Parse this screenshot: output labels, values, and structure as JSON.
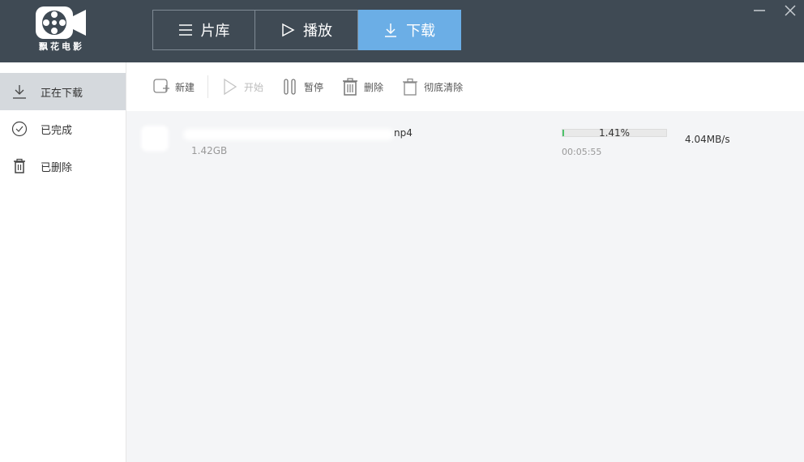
{
  "app": {
    "logo_text": "飘花电影",
    "tabs": [
      {
        "label": "片库",
        "icon": "menu-icon"
      },
      {
        "label": "播放",
        "icon": "play-icon"
      },
      {
        "label": "下载",
        "icon": "download-icon",
        "active": true
      }
    ],
    "window_controls": [
      "minimize-icon",
      "close-icon"
    ]
  },
  "sidebar": {
    "items": [
      {
        "label": "正在下载",
        "icon": "download-icon",
        "active": true
      },
      {
        "label": "已完成",
        "icon": "check-circle-icon"
      },
      {
        "label": "已删除",
        "icon": "trash-icon"
      }
    ]
  },
  "toolbar": {
    "new_label": "新建",
    "start_label": "开始",
    "pause_label": "暂停",
    "delete_label": "删除",
    "purge_label": "彻底清除"
  },
  "downloads": [
    {
      "filename_tail": "np4",
      "size": "1.42GB",
      "progress_text": "1.41%",
      "progress": 0.0141,
      "time_left": "00:05:55",
      "speed": "4.04MB/s"
    }
  ],
  "colors": {
    "titlebar": "#3f4a54",
    "active_tab": "#6baee6",
    "sidebar_active": "#d5d9dd",
    "progress": "#4fc26b"
  }
}
